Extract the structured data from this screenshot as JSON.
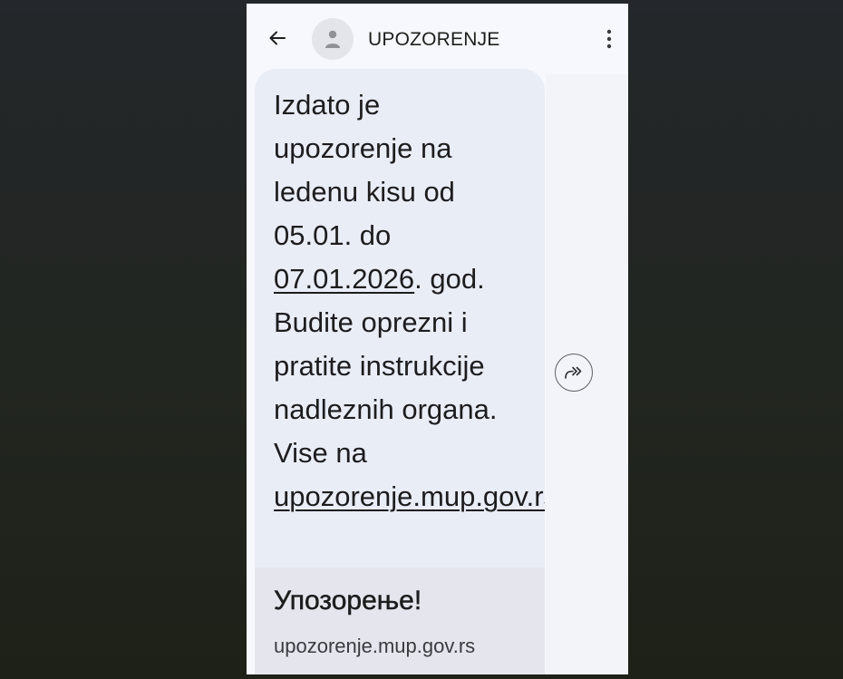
{
  "header": {
    "title": "UPOZORENJE",
    "back_icon": "arrow-back-icon",
    "avatar_icon": "person-icon",
    "menu_icon": "more-vert-icon"
  },
  "message": {
    "text_part1": "Izdato je\nupozorenje na\nledenu kisu od\n05.01. do\n",
    "date_link": "07.01.2026",
    "text_part2": ". god.\nBudite oprezni i\npratite instrukcije\nnadleznih organa.\nVise na\n",
    "url_link": "upozorenje.mup.gov.rs"
  },
  "link_preview": {
    "title": "Упозорење!",
    "domain": "upozorenje.mup.gov.rs"
  },
  "actions": {
    "forward_icon": "forward-icon"
  },
  "colors": {
    "screen_bg": "#f7f8fd",
    "bubble_bg": "#e9edf6",
    "preview_bg": "#e5e6ed",
    "text": "#1d1d1f"
  }
}
